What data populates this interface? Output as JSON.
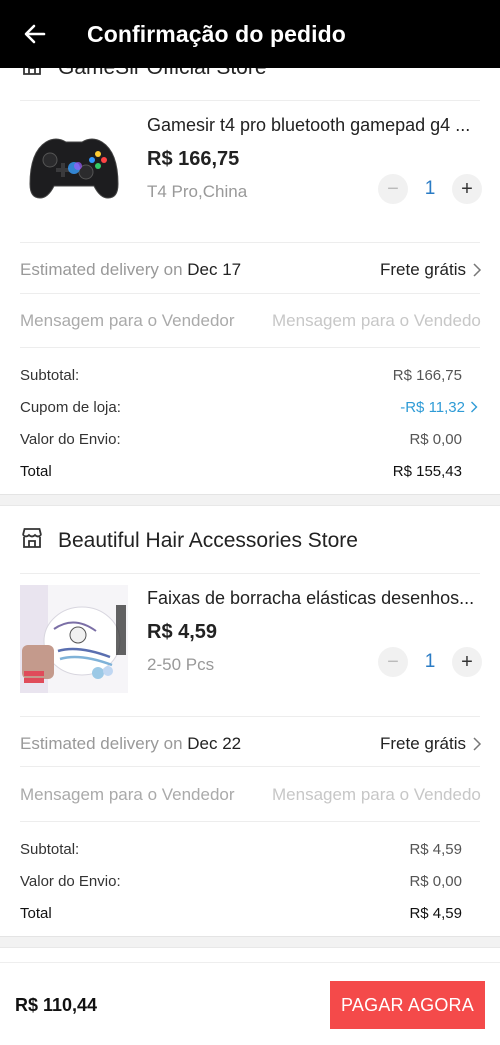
{
  "header": {
    "title": "Confirmação do pedido"
  },
  "stores": [
    {
      "name": "GameSir Official Store",
      "product": {
        "title": "Gamesir t4 pro bluetooth gamepad g4 ...",
        "price": "R$ 166,75",
        "variant": "T4 Pro,China",
        "quantity": "1"
      },
      "delivery": {
        "label": "Estimated delivery on ",
        "date": "Dec 17",
        "shipping": "Frete grátis"
      },
      "message": {
        "label": "Mensagem para o Vendedor",
        "placeholder": "Mensagem para o Vendedor"
      },
      "summary": {
        "subtotal_label": "Subtotal:",
        "subtotal": "R$ 166,75",
        "coupon_label": "Cupom de loja:",
        "coupon": "-R$ 11,32",
        "shipping_label": "Valor do Envio:",
        "shipping": "R$ 0,00",
        "total_label": "Total",
        "total": "R$ 155,43"
      }
    },
    {
      "name": "Beautiful Hair Accessories Store",
      "product": {
        "title": "Faixas de borracha elásticas desenhos...",
        "price": "R$ 4,59",
        "variant": "2-50 Pcs",
        "quantity": "1"
      },
      "delivery": {
        "label": "Estimated delivery on ",
        "date": "Dec 22",
        "shipping": "Frete grátis"
      },
      "message": {
        "label": "Mensagem para o Vendedor",
        "placeholder": "Mensagem para o Vendedor"
      },
      "summary": {
        "subtotal_label": "Subtotal:",
        "subtotal": "R$ 4,59",
        "shipping_label": "Valor do Envio:",
        "shipping": "R$ 0,00",
        "total_label": "Total",
        "total": "R$ 4,59"
      }
    }
  ],
  "footer": {
    "total": "R$ 110,44",
    "pay_label": "PAGAR AGORA"
  },
  "colors": {
    "header_bg": "#000000",
    "accent_red": "#f44a4a",
    "link_blue": "#2f9bd6",
    "qty_blue": "#2a7bc4"
  },
  "icons": {
    "back": "arrow-left-icon",
    "store": "store-icon",
    "chevron": "chevron-right-icon"
  }
}
